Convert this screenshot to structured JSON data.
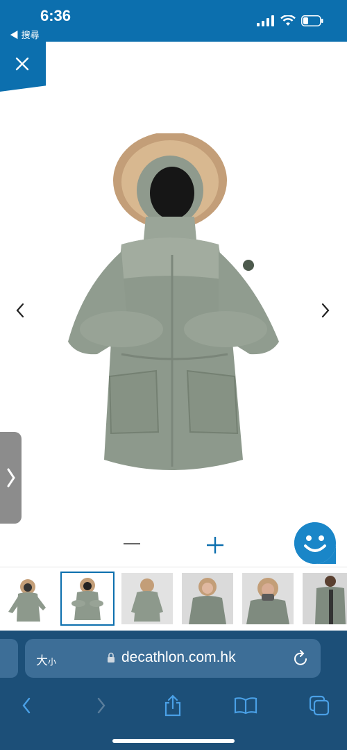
{
  "status_bar": {
    "time": "6:36",
    "back_label": "◀ 搜尋"
  },
  "close_tab": {
    "icon": "close-icon"
  },
  "product": {
    "description_icon": "parka-image"
  },
  "gallery": {
    "prev_icon": "chevron-left-icon",
    "next_icon": "chevron-right-icon",
    "side_tab_icon": "chevron-right-icon",
    "thumbnails_count_visible": 6,
    "active_index": 1
  },
  "zoom": {
    "minus_icon": "minus-icon",
    "plus_icon": "plus-icon"
  },
  "chat": {
    "icon": "smiley-icon"
  },
  "browser": {
    "text_size_label": "大",
    "text_size_small": "小",
    "url": "decathlon.com.hk"
  },
  "colors": {
    "brand": "#0c6fae",
    "browser_bg": "#1c4f78",
    "urlbar_bg": "#3d6e97",
    "jacket": "#8a968a",
    "fur": "#c4a07a"
  }
}
